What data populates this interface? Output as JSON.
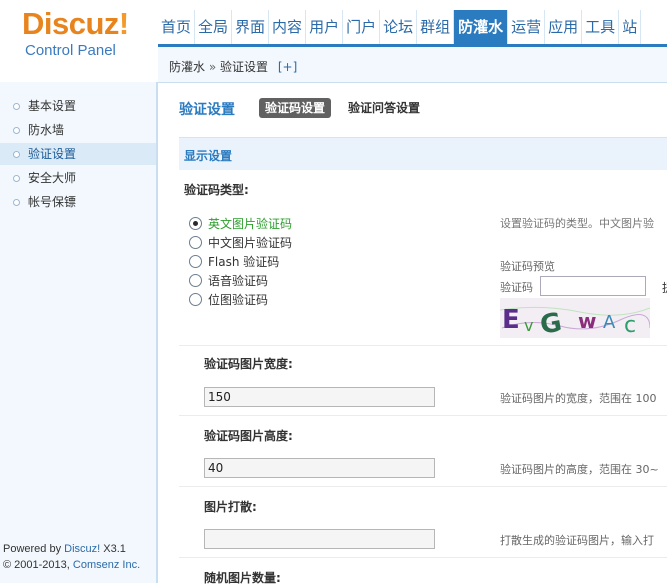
{
  "logo": {
    "word": "Discuz",
    "bang": "!",
    "subtitle": "Control Panel"
  },
  "topnav": [
    {
      "label": "首页",
      "active": false
    },
    {
      "label": "全局",
      "active": false
    },
    {
      "label": "界面",
      "active": false
    },
    {
      "label": "内容",
      "active": false
    },
    {
      "label": "用户",
      "active": false
    },
    {
      "label": "门户",
      "active": false
    },
    {
      "label": "论坛",
      "active": false
    },
    {
      "label": "群组",
      "active": false
    },
    {
      "label": "防灌水",
      "active": true
    },
    {
      "label": "运营",
      "active": false
    },
    {
      "label": "应用",
      "active": false
    },
    {
      "label": "工具",
      "active": false
    },
    {
      "label": "站",
      "active": false
    }
  ],
  "breadcrumb": {
    "parent": "防灌水",
    "sep": "»",
    "current": "验证设置",
    "add": "[+]"
  },
  "sidebar": {
    "items": [
      {
        "label": "基本设置",
        "active": false
      },
      {
        "label": "防水墙",
        "active": false
      },
      {
        "label": "验证设置",
        "active": true
      },
      {
        "label": "安全大师",
        "active": false
      },
      {
        "label": "帐号保镖",
        "active": false
      }
    ],
    "powered_prefix": "Powered by ",
    "powered_brand": "Discuz!",
    "powered_version": " X3.1",
    "copyright_prefix": "© 2001-2013, ",
    "copyright_brand": "Comsenz Inc."
  },
  "main": {
    "title": "验证设置",
    "tabs": [
      {
        "label": "验证码设置",
        "active": true
      },
      {
        "label": "验证问答设置",
        "active": false
      }
    ],
    "section": "显示设置",
    "captcha_type": {
      "label": "验证码类型:",
      "options": [
        {
          "label": "英文图片验证码",
          "checked": true
        },
        {
          "label": "中文图片验证码",
          "checked": false
        },
        {
          "label": "Flash 验证码",
          "checked": false
        },
        {
          "label": "语音验证码",
          "checked": false
        },
        {
          "label": "位图验证码",
          "checked": false
        }
      ],
      "tip": "设置验证码的类型。中文图片验",
      "preview_label": "验证码预览",
      "preview_field_label": "验证码",
      "preview_value": "",
      "preview_extra": "提",
      "preview_code": "EvGwAc"
    },
    "width": {
      "label": "验证码图片宽度:",
      "value": "150",
      "tip": "验证码图片的宽度，范围在 100"
    },
    "height": {
      "label": "验证码图片高度:",
      "value": "40",
      "tip": "验证码图片的高度，范围在 30~"
    },
    "scatter": {
      "label": "图片打散:",
      "value": "",
      "tip": "打散生成的验证码图片，输入打"
    },
    "next_label": "随机图片数量:"
  },
  "colors": {
    "accent": "#2b7bc0",
    "logo": "#e8841d",
    "checked_text": "#2e9e2e"
  }
}
